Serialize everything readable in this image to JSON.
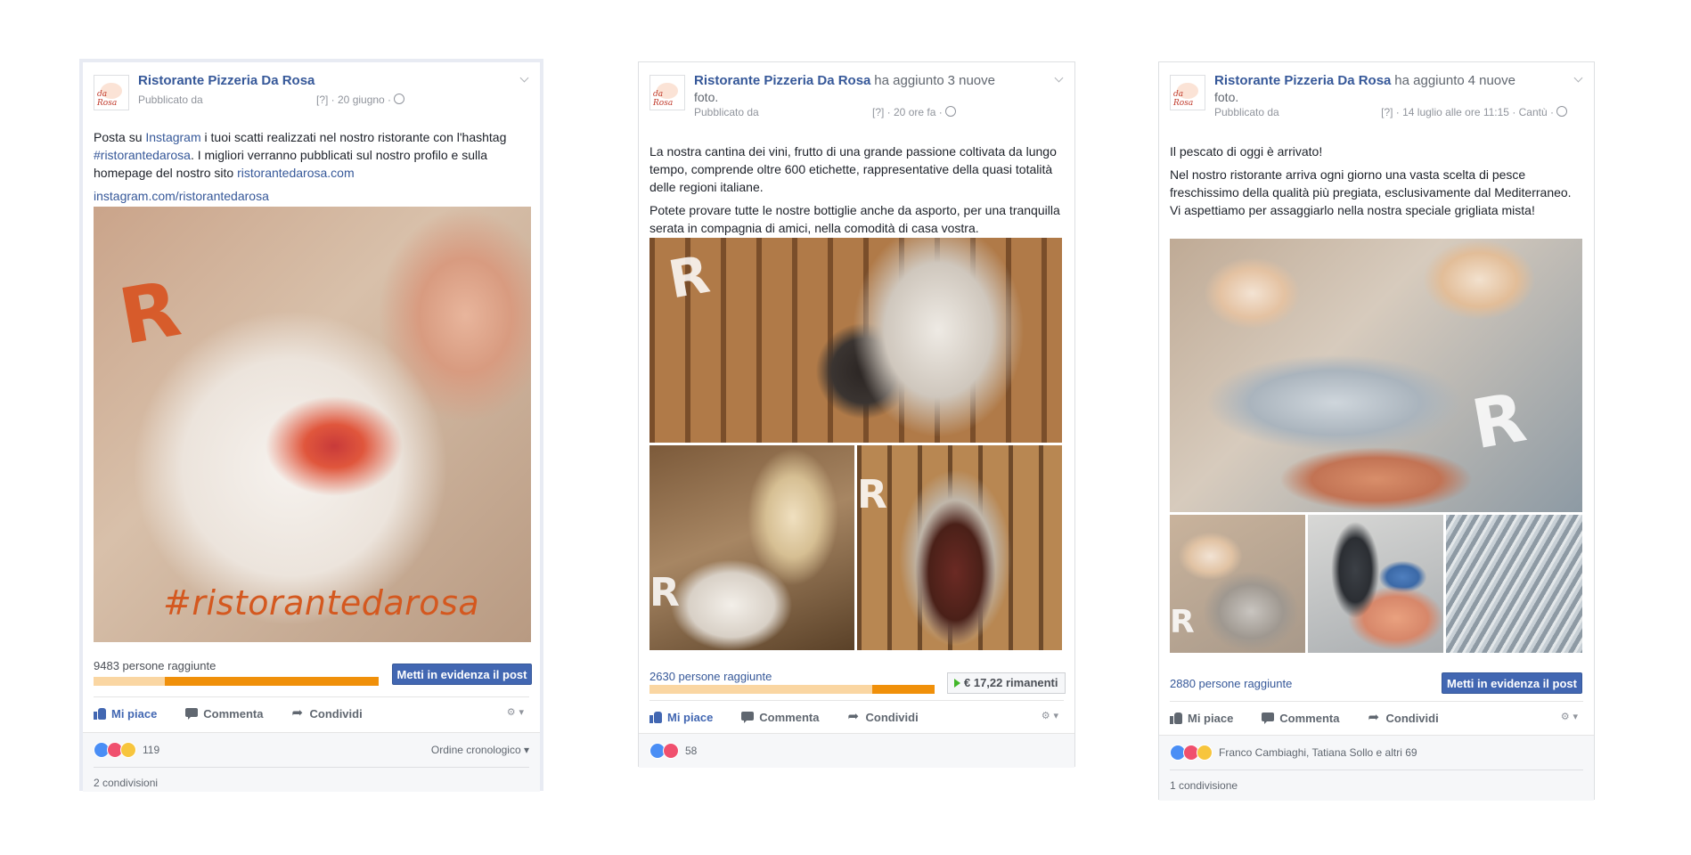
{
  "posts": [
    {
      "page_name": "Ristorante Pizzeria Da Rosa",
      "action": "",
      "action_cont": "",
      "published_by": "Pubblicato da",
      "meta": "[?] · 20 giugno ·",
      "body": [
        "Posta su Instagram i tuoi scatti realizzati nel nostro ristorante con l'hashtag #ristorantedarosa. I migliori verranno pubblicati sul nostro profilo e sulla homepage del nostro sito ristorantedarosa.com"
      ],
      "body_parts": {
        "a": "Posta su ",
        "b": "Instagram",
        "c": " i tuoi scatti realizzati nel nostro ristorante con l'hashtag ",
        "d": "#ristorantedarosa",
        "e": ". I migliori verranno pubblicati sul nostro profilo e sulla homepage del nostro sito ",
        "f": "ristorantedarosa.com"
      },
      "link": "instagram.com/ristorantedarosa",
      "image_text": "#ristorantedarosa",
      "reach_label": "9483 persone raggiunte",
      "reach_fraction": 0.75,
      "boost_label": "Metti in evidenza il post",
      "actions": {
        "like": "Mi piace",
        "comment": "Commenta",
        "share": "Condividi"
      },
      "reactions_count": "119",
      "order_label": "Ordine cronologico ▾",
      "shares_label": "2 condivisioni"
    },
    {
      "page_name": "Ristorante Pizzeria Da Rosa",
      "action": "ha aggiunto",
      "action_count": "3 nuove",
      "action_cont": "foto.",
      "published_by": "Pubblicato da",
      "meta": "[?] · 20 ore fa ·",
      "body": [
        "La nostra cantina dei vini, frutto di una grande passione coltivata da lungo tempo, comprende oltre 600 etichette, rappresentative della quasi totalità delle regioni italiane.",
        "Potete provare tutte le nostre bottiglie anche da asporto, per una tranquilla serata in compagnia di amici, nella comodità di casa vostra."
      ],
      "reach_label": "2630 persone raggiunte",
      "reach_fraction": 0.22,
      "remaining_label": "€ 17,22 rimanenti",
      "actions": {
        "like": "Mi piace",
        "comment": "Commenta",
        "share": "Condividi"
      },
      "reactions_count": "58"
    },
    {
      "page_name": "Ristorante Pizzeria Da Rosa",
      "action": "ha aggiunto",
      "action_count": "4 nuove",
      "action_cont": "foto.",
      "published_by": "Pubblicato da",
      "meta": "[?] · 14 luglio alle ore 11:15 · Cantù ·",
      "body": [
        "Il pescato di oggi è arrivato!",
        "Nel nostro ristorante arriva ogni giorno una vasta scelta di pesce freschissimo della qualità più pregiata, esclusivamente dal Mediterraneo. Vi aspettiamo per assaggiarlo nella nostra speciale grigliata mista!"
      ],
      "reach_label": "2880 persone raggiunte",
      "boost_label": "Metti in evidenza il post",
      "actions": {
        "like": "Mi piace",
        "comment": "Commenta",
        "share": "Condividi"
      },
      "reactions_names": "Franco Cambiaghi, Tatiana Sollo e altri 69",
      "shares_label": "1 condivisione"
    }
  ],
  "avatar_text": "da Rosa",
  "colors": {
    "facebook_blue": "#4267b2",
    "link_blue": "#365899",
    "reach_bar_fill": "#f0900a",
    "reach_bar_track": "#fad6a2",
    "hashtag_orange": "#d4581f"
  },
  "icons": [
    "like-icon",
    "comment-icon",
    "share-icon",
    "globe-icon",
    "chevron-down-icon",
    "audience-selector-icon"
  ]
}
